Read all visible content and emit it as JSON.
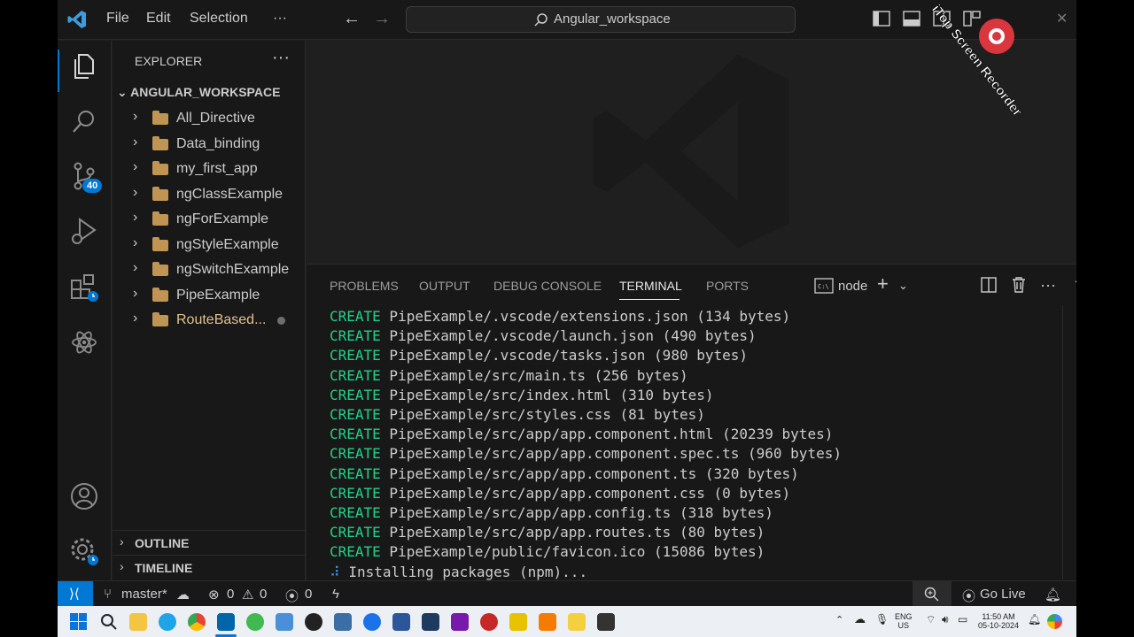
{
  "menu": {
    "file": "File",
    "edit": "Edit",
    "selection": "Selection",
    "more": "···"
  },
  "command_center": {
    "query": "Angular_workspace"
  },
  "activity_bar": {
    "scm_badge": "40"
  },
  "explorer": {
    "title": "EXPLORER",
    "more": "···",
    "workspace": "ANGULAR_WORKSPACE",
    "folders": [
      {
        "name": "All_Directive"
      },
      {
        "name": "Data_binding"
      },
      {
        "name": "my_first_app"
      },
      {
        "name": "ngClassExample"
      },
      {
        "name": "ngForExample"
      },
      {
        "name": "ngStyleExample"
      },
      {
        "name": "ngSwitchExample"
      },
      {
        "name": "PipeExample"
      },
      {
        "name": "RouteBased..."
      }
    ],
    "outline": "OUTLINE",
    "timeline": "TIMELINE"
  },
  "panel": {
    "tabs": [
      "PROBLEMS",
      "OUTPUT",
      "DEBUG CONSOLE",
      "TERMINAL",
      "PORTS"
    ],
    "active_tab": "TERMINAL",
    "terminal_name": "node"
  },
  "terminal": {
    "keyword": "CREATE",
    "lines": [
      "PipeExample/.vscode/extensions.json (134 bytes)",
      "PipeExample/.vscode/launch.json (490 bytes)",
      "PipeExample/.vscode/tasks.json (980 bytes)",
      "PipeExample/src/main.ts (256 bytes)",
      "PipeExample/src/index.html (310 bytes)",
      "PipeExample/src/styles.css (81 bytes)",
      "PipeExample/src/app/app.component.html (20239 bytes)",
      "PipeExample/src/app/app.component.spec.ts (960 bytes)",
      "PipeExample/src/app/app.component.ts (320 bytes)",
      "PipeExample/src/app/app.component.css (0 bytes)",
      "PipeExample/src/app/app.config.ts (318 bytes)",
      "PipeExample/src/app/app.routes.ts (80 bytes)",
      "PipeExample/public/favicon.ico (15086 bytes)"
    ],
    "spinner": "⠼",
    "status_line": "Installing packages (npm)..."
  },
  "statusbar": {
    "branch": "master*",
    "errors": "0",
    "warnings": "0",
    "ports": "0",
    "go_live": "Go Live"
  },
  "taskbar": {
    "lang": "ENG",
    "region": "US",
    "time": "11:50 AM",
    "date": "05-10-2024"
  },
  "overlay": {
    "recorder_text": "iTop Screen Recorder"
  }
}
